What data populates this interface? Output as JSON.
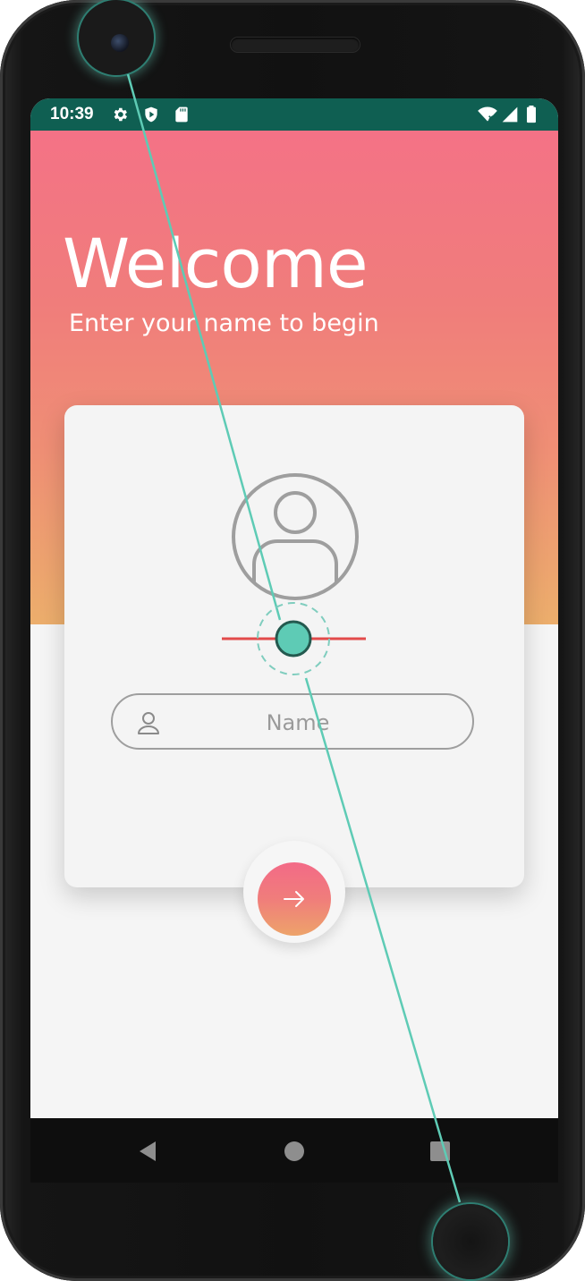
{
  "status_bar": {
    "time": "10:39",
    "icons": [
      "gear-icon",
      "shield-icon",
      "sd-card-icon",
      "wifi-off-icon",
      "signal-icon",
      "battery-icon"
    ]
  },
  "header": {
    "title": "Welcome",
    "subtitle": "Enter your name to begin"
  },
  "form": {
    "avatar_icon": "user-circle-icon",
    "name_icon": "person-icon",
    "name_value": "",
    "name_placeholder": "Name",
    "submit_icon": "arrow-right-icon"
  },
  "nav_bar": {
    "buttons": [
      "back-icon",
      "home-icon",
      "recents-icon"
    ]
  },
  "colors": {
    "status_bar": "#0f5f52",
    "gradient_top": "#f47286",
    "gradient_bottom": "#ecae6c",
    "card": "#f4f4f4",
    "accent_teal": "#5ecbb5",
    "marker_red": "#e24a4a"
  }
}
